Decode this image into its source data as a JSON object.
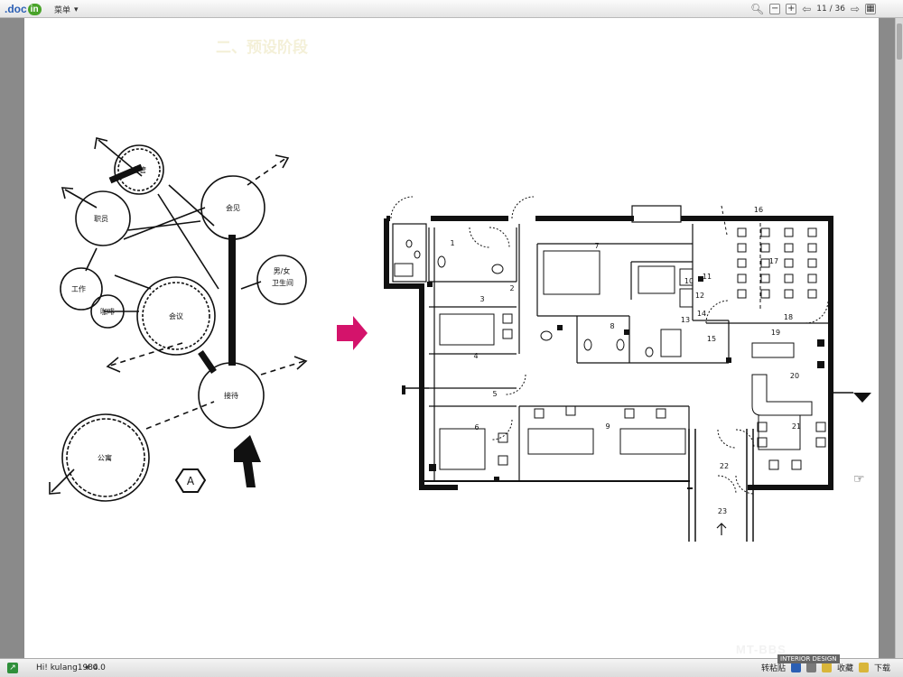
{
  "toolbar": {
    "logo_text": ".doc",
    "logo_badge": "in",
    "menu_label": "菜单",
    "page_current": "11",
    "page_sep": "/",
    "page_total": "36"
  },
  "page": {
    "title": "二、预设阶段"
  },
  "bubble_diagram": {
    "nodes": [
      "主管",
      "职员",
      "会见",
      "男/女卫生间",
      "工作",
      "咖啡",
      "会议",
      "接待",
      "公寓"
    ],
    "badge": "A"
  },
  "floor_plan": {
    "room_numbers": [
      "1",
      "2",
      "3",
      "4",
      "5",
      "6",
      "7",
      "8",
      "9",
      "10",
      "11",
      "12",
      "13",
      "14",
      "15",
      "16",
      "17",
      "18",
      "19",
      "20",
      "21",
      "22",
      "23"
    ]
  },
  "status": {
    "user": "Hi! kulang1984",
    "balance": "¥ 0.0",
    "right_text_1": "转粘贴",
    "right_text_2": "收藏",
    "right_text_3": "下载",
    "watermark": "MT-BBS",
    "interior_badge": "INTERIOR DESIGN"
  },
  "colors": {
    "accent_pink": "#d4136b",
    "logo_blue": "#2b5fb4",
    "logo_green": "#49a329"
  }
}
